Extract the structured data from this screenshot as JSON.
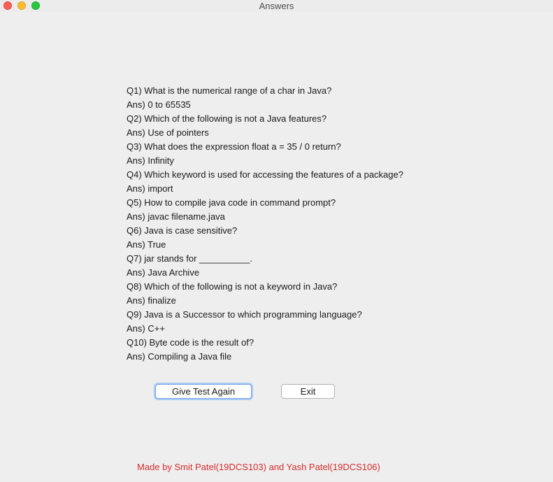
{
  "window": {
    "title": "Answers"
  },
  "qa": [
    {
      "q": "Q1) What is the numerical range of a char in Java?",
      "a": "Ans) 0 to 65535"
    },
    {
      "q": "Q2) Which of the following is not a Java features?",
      "a": "Ans) Use of pointers"
    },
    {
      "q": "Q3) What does the expression float a = 35 / 0 return?",
      "a": "Ans) Infinity"
    },
    {
      "q": "Q4) Which keyword is used for accessing the features of a package?",
      "a": "Ans) import"
    },
    {
      "q": "Q5) How to compile java code in command prompt?",
      "a": "Ans) javac filename.java"
    },
    {
      "q": "Q6) Java is case sensitive?",
      "a": "Ans) True"
    },
    {
      "q": "Q7) jar stands for __________.",
      "a": "Ans) Java Archive"
    },
    {
      "q": "Q8) Which of the following is not a keyword in Java?",
      "a": "Ans) finalize"
    },
    {
      "q": "Q9) Java is a Successor to which programming language?",
      "a": "Ans) C++"
    },
    {
      "q": "Q10) Byte code is the result of?",
      "a": "Ans) Compiling a Java file"
    }
  ],
  "buttons": {
    "give_test_again": "Give Test Again",
    "exit": "Exit"
  },
  "footer": {
    "credits": "Made by Smit Patel(19DCS103) and Yash Patel(19DCS106)"
  },
  "colors": {
    "credits_text": "#d62c2c",
    "focus_ring": "#a9c9f5"
  }
}
